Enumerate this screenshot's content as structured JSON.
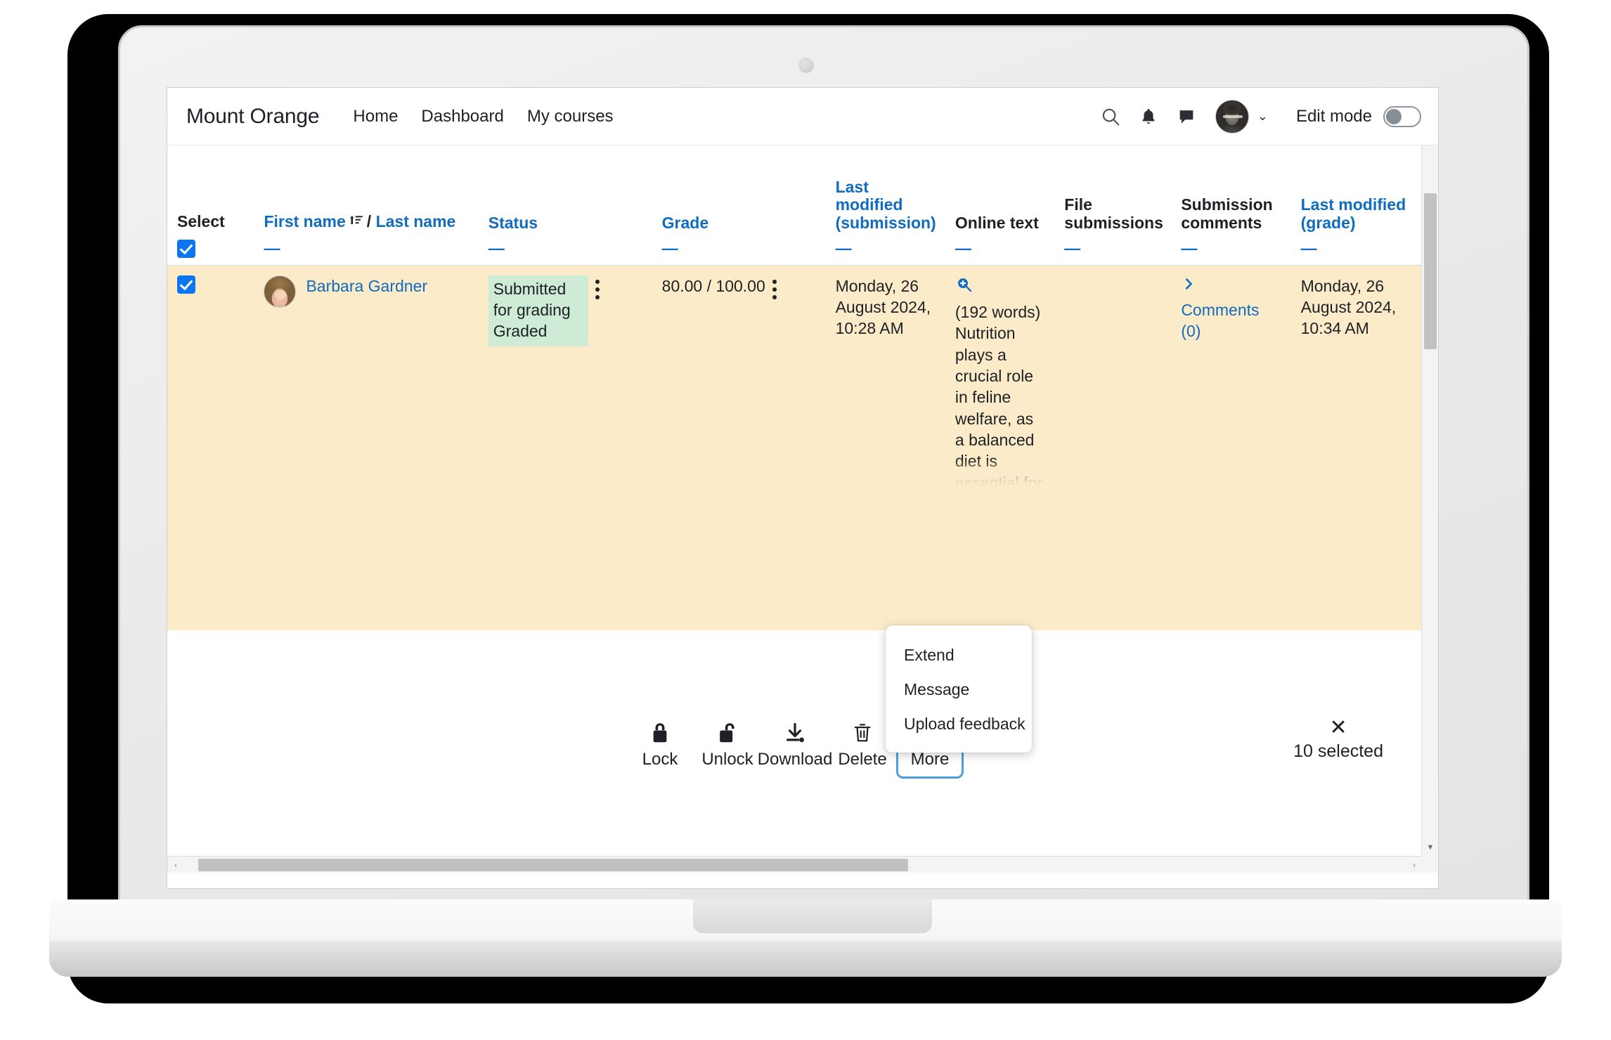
{
  "navbar": {
    "brand": "Mount Orange",
    "links": [
      {
        "label": "Home"
      },
      {
        "label": "Dashboard"
      },
      {
        "label": "My courses"
      }
    ],
    "icons": {
      "search": "search-icon",
      "notifications": "bell-icon",
      "messages": "message-icon",
      "avatar": "user-avatar",
      "chevron": "chevron-down-icon"
    },
    "edit_mode_label": "Edit mode",
    "edit_mode_on": false
  },
  "table": {
    "headers": [
      {
        "label": "Select",
        "link": false,
        "sublink": "",
        "has_checkbox": true
      },
      {
        "label": "First name",
        "link": true,
        "sublink": "—",
        "slash": "/",
        "second_label": "Last name",
        "sorted": true
      },
      {
        "label": "Status",
        "link": true,
        "sublink": "—"
      },
      {
        "label": "Grade",
        "link": true,
        "sublink": "—"
      },
      {
        "label": "Last modified (submission)",
        "link": true,
        "sublink": "—"
      },
      {
        "label": "Online text",
        "link": false,
        "sublink": "—"
      },
      {
        "label": "File submissions",
        "link": false,
        "sublink": "—"
      },
      {
        "label": "Submission comments",
        "link": false,
        "sublink": "—"
      },
      {
        "label": "Last modified (grade)",
        "link": true,
        "sublink": "—"
      }
    ],
    "rows": [
      {
        "selected": true,
        "name": "Barbara Gardner",
        "status_line1": "Submitted for grading",
        "status_line2": "Graded",
        "grade": "80.00 / 100.00",
        "last_modified_submission": "Monday, 26 August 2024, 10:28 AM",
        "online_text_wordcount": "(192 words)",
        "online_text_body": "Nutrition plays a crucial role in feline welfare, as a balanced diet is essential for a cat's",
        "file_submissions": "",
        "submission_comments": "Comments (0)",
        "last_modified_grade": "Monday, 26 August 2024, 10:34 AM"
      }
    ]
  },
  "more_menu": {
    "items": [
      {
        "label": "Extend"
      },
      {
        "label": "Message"
      },
      {
        "label": "Upload feedback"
      }
    ]
  },
  "action_bar": {
    "actions": [
      {
        "label": "Lock",
        "icon": "lock-closed-icon",
        "focused": false
      },
      {
        "label": "Unlock",
        "icon": "lock-open-icon",
        "focused": false
      },
      {
        "label": "Download",
        "icon": "download-icon",
        "focused": false
      },
      {
        "label": "Delete",
        "icon": "trash-icon",
        "focused": false
      },
      {
        "label": "More",
        "icon": "kebab-menu-icon",
        "focused": true
      }
    ],
    "close_glyph": "✕",
    "selected_count_label": "10 selected"
  },
  "help": {
    "glyph": "?"
  },
  "colors": {
    "link": "#0f6cbf",
    "row_highlight": "#fbebc8",
    "status_badge": "#cdebd5",
    "checkbox": "#0b76ef",
    "focus_ring": "#4a9fe0"
  }
}
